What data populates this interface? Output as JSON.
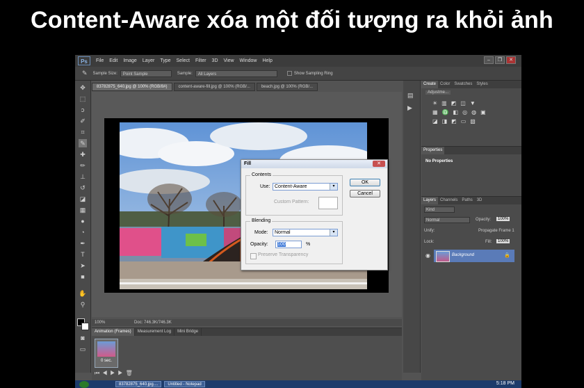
{
  "headline": "Content-Aware xóa một đối tượng ra khỏi ảnh",
  "app": {
    "logo": "Ps",
    "menu": [
      "File",
      "Edit",
      "Image",
      "Layer",
      "Type",
      "Select",
      "Filter",
      "3D",
      "View",
      "Window",
      "Help"
    ]
  },
  "options_bar": {
    "sample_size_label": "Sample Size:",
    "sample_size_value": "Point Sample",
    "sample_label": "Sample:",
    "sample_value": "All Layers",
    "show_sampling_ring": "Show Sampling Ring"
  },
  "doc_tabs": [
    "83782875_640.jpg @ 100% (RGB/8#)",
    "content-aware-fill.jpg @ 100% (RGB/...",
    "beach.jpg @ 100% (RGB/..."
  ],
  "status": {
    "zoom": "100%",
    "doc": "Doc: 746.3K/746.3K"
  },
  "anim_tabs": [
    "Animation (Frames)",
    "Measurement Log",
    "Mini Bridge"
  ],
  "frame": {
    "delay": "0 sec."
  },
  "panels": {
    "top_tabs": [
      "Create",
      "Color",
      "Swatches",
      "Styles"
    ],
    "adjustments_label": "Adjustme...",
    "properties_tab": "Properties",
    "no_properties": "No Properties",
    "layers_tabs": [
      "Layers",
      "Channels",
      "Paths",
      "3D"
    ],
    "kind_label": "Kind",
    "blend_mode": "Normal",
    "opacity_label": "Opacity:",
    "opacity_value": "100%",
    "unify_label": "Unify:",
    "propagate_label": "Propagate Frame 1",
    "lock_label": "Lock:",
    "fill_label": "Fill:",
    "fill_value": "100%",
    "layer_name": "Background"
  },
  "dialog": {
    "title": "Fill",
    "contents_legend": "Contents",
    "use_label": "Use:",
    "use_value": "Content-Aware",
    "custom_pattern_label": "Custom Pattern:",
    "blending_legend": "Blending",
    "mode_label": "Mode:",
    "mode_value": "Normal",
    "opacity_label": "Opacity:",
    "opacity_value": "100",
    "percent": "%",
    "preserve_label": "Preserve Transparency",
    "ok": "OK",
    "cancel": "Cancel"
  },
  "taskbar": {
    "item1": "83782875_640.jpg....",
    "item2": "Untitled - Notepad",
    "clock": "5:18 PM"
  }
}
